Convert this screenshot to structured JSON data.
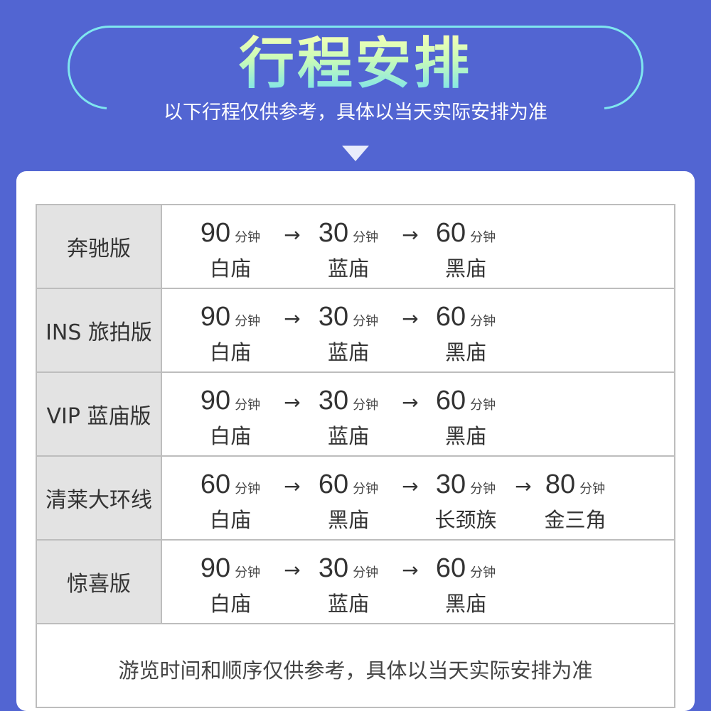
{
  "header": {
    "title": "行程安排",
    "subtitle": "以下行程仅供参考，具体以当天实际安排为准"
  },
  "rows": [
    {
      "label": "奔驰版",
      "steps": [
        {
          "minutes": "90",
          "unit": "分钟",
          "place": "白庙"
        },
        {
          "minutes": "30",
          "unit": "分钟",
          "place": "蓝庙"
        },
        {
          "minutes": "60",
          "unit": "分钟",
          "place": "黑庙"
        }
      ]
    },
    {
      "label": "INS 旅拍版",
      "steps": [
        {
          "minutes": "90",
          "unit": "分钟",
          "place": "白庙"
        },
        {
          "minutes": "30",
          "unit": "分钟",
          "place": "蓝庙"
        },
        {
          "minutes": "60",
          "unit": "分钟",
          "place": "黑庙"
        }
      ]
    },
    {
      "label": "VIP 蓝庙版",
      "steps": [
        {
          "minutes": "90",
          "unit": "分钟",
          "place": "白庙"
        },
        {
          "minutes": "30",
          "unit": "分钟",
          "place": "蓝庙"
        },
        {
          "minutes": "60",
          "unit": "分钟",
          "place": "黑庙"
        }
      ]
    },
    {
      "label": "清莱大环线",
      "steps": [
        {
          "minutes": "60",
          "unit": "分钟",
          "place": "白庙"
        },
        {
          "minutes": "60",
          "unit": "分钟",
          "place": "黑庙"
        },
        {
          "minutes": "30",
          "unit": "分钟",
          "place": "长颈族"
        },
        {
          "minutes": "80",
          "unit": "分钟",
          "place": "金三角"
        }
      ]
    },
    {
      "label": "惊喜版",
      "steps": [
        {
          "minutes": "90",
          "unit": "分钟",
          "place": "白庙"
        },
        {
          "minutes": "30",
          "unit": "分钟",
          "place": "蓝庙"
        },
        {
          "minutes": "60",
          "unit": "分钟",
          "place": "黑庙"
        }
      ]
    }
  ],
  "arrow_glyph": "→",
  "footer_note": "游览时间和顺序仅供参考，具体以当天实际安排为准",
  "colors": {
    "background": "#5265d2",
    "accent": "#7fe6ef",
    "label_cell": "#e3e3e3"
  }
}
